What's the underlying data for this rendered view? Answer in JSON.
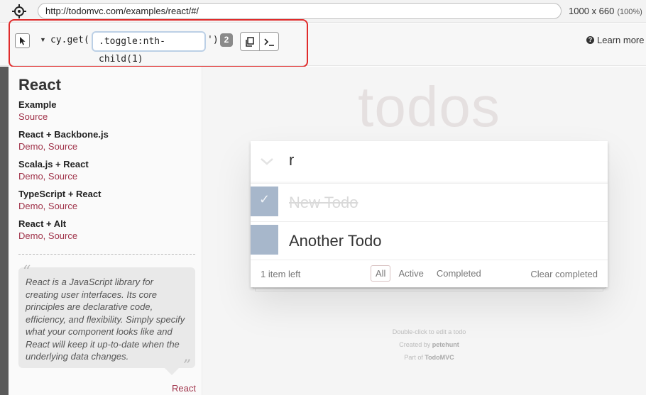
{
  "browser": {
    "url": "http://todomvc.com/examples/react/#/",
    "viewport_size": "1000 x 660",
    "viewport_scale": "(100%)"
  },
  "selector_playground": {
    "method_prefix": "cy.get('",
    "selector": ".toggle:nth-child(1)",
    "method_suffix": "')",
    "match_count": "2",
    "learn_more": "Learn more"
  },
  "sidebar": {
    "title": "React",
    "items": [
      {
        "heading": "Example",
        "links": "Source"
      },
      {
        "heading": "React + Backbone.js",
        "links": "Demo, Source"
      },
      {
        "heading": "Scala.js + React",
        "links": "Demo, Source"
      },
      {
        "heading": "TypeScript + React",
        "links": "Demo, Source"
      },
      {
        "heading": "React + Alt",
        "links": "Demo, Source"
      }
    ],
    "quote": "React is a JavaScript library for creating user interfaces. Its core principles are declarative code, efficiency, and flexibility. Simply specify what your component looks like and React will keep it up-to-date when the underlying data changes.",
    "quote_footer": "React"
  },
  "todo_app": {
    "title": "todos",
    "new_todo_value": "r",
    "todos": [
      {
        "label": "New Todo",
        "completed": true
      },
      {
        "label": "Another Todo",
        "completed": false
      }
    ],
    "footer": {
      "items_left": "1 item left",
      "filters": [
        "All",
        "Active",
        "Completed"
      ],
      "selected_filter": "All",
      "clear_completed": "Clear completed"
    }
  },
  "info": {
    "line1": "Double-click to edit a todo",
    "line2_prefix": "Created by",
    "line2_author": "petehunt",
    "line3_prefix": "Part of",
    "line3_link": "TodoMVC"
  },
  "colors": {
    "highlight_border": "#e02b2b",
    "link": "#a0334a",
    "toggle_fill": "#a7b7cb"
  },
  "icons": {
    "crosshair": "crosshair-icon",
    "selector_picker": "cursor-icon",
    "copy": "copy-icon",
    "console": "terminal-icon",
    "help": "question-icon",
    "toggle_all": "chevron-down-icon",
    "check": "check-icon"
  }
}
